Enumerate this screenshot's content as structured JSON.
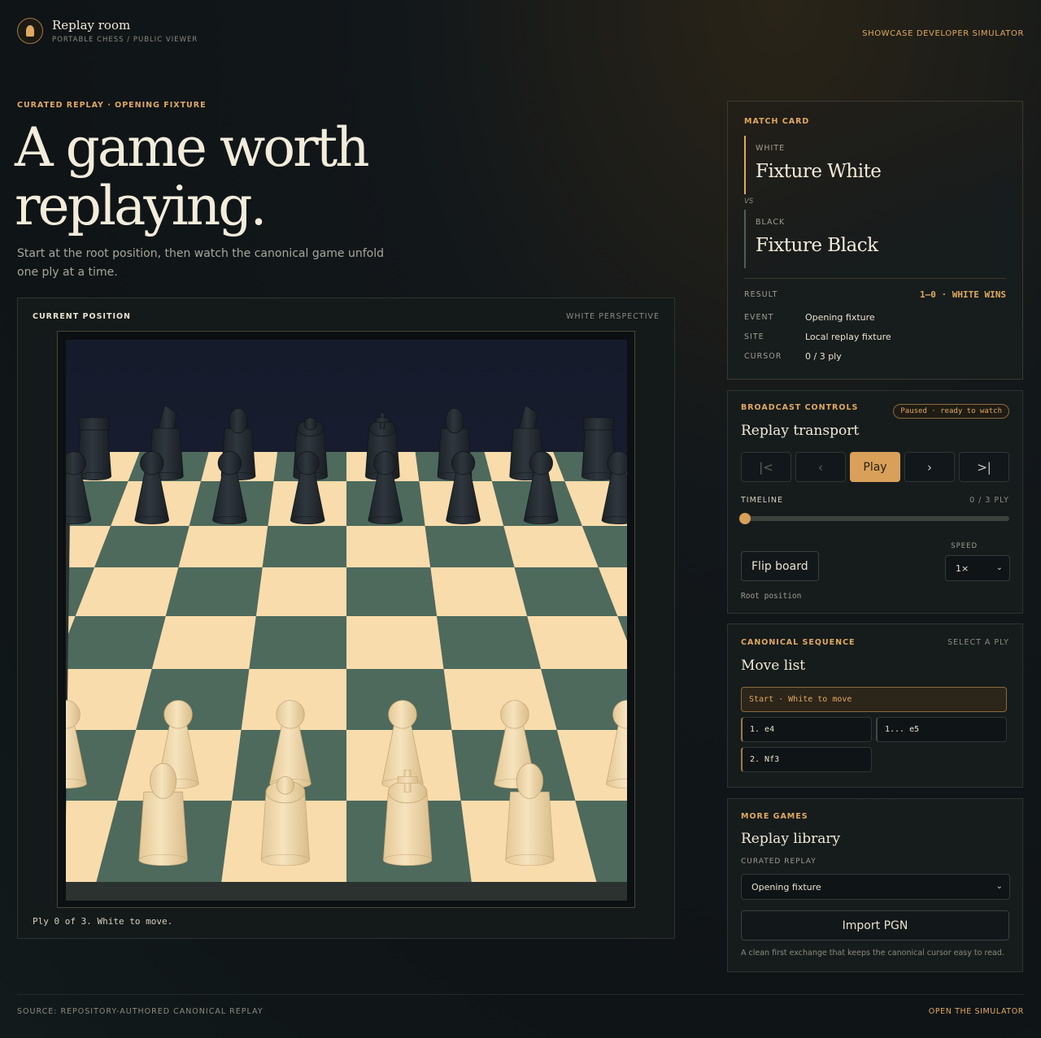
{
  "header": {
    "app_title": "Replay room",
    "app_subtitle": "PORTABLE CHESS / PUBLIC VIEWER",
    "logo_icon": "knight-icon",
    "dev_link": "SHOWCASE DEVELOPER SIMULATOR"
  },
  "hero": {
    "eyebrow": "CURATED REPLAY · OPENING FIXTURE",
    "title_line1": "A game worth",
    "title_line2": "replaying.",
    "subtitle": "Start at the root position, then watch the canonical game unfold one ply at a time."
  },
  "board": {
    "label": "CURRENT POSITION",
    "perspective": "WHITE PERSPECTIVE",
    "status": "Ply 0 of 3. White to move.",
    "colors": {
      "light_square": "#f9dcac",
      "dark_square": "#4d6a5d",
      "white_piece": "#f0d9ad",
      "black_piece": "#232a30"
    }
  },
  "match": {
    "eyebrow": "MATCH CARD",
    "white_label": "WHITE",
    "white_name": "Fixture White",
    "vs": "VS",
    "black_label": "BLACK",
    "black_name": "Fixture Black",
    "result_label": "RESULT",
    "result_value": "1–0 · WHITE WINS",
    "event_label": "EVENT",
    "event_value": "Opening fixture",
    "site_label": "SITE",
    "site_value": "Local replay fixture",
    "cursor_label": "CURSOR",
    "cursor_value": "0 / 3 ply"
  },
  "controls": {
    "eyebrow": "BROADCAST CONTROLS",
    "title": "Replay transport",
    "badge": "Paused · ready to watch",
    "first_label": "|<",
    "prev_label": "‹",
    "play_label": "Play",
    "next_label": "›",
    "last_label": ">|",
    "timeline_label": "TIMELINE",
    "timeline_value": "0 / 3 PLY",
    "timeline_progress": 0,
    "flip_label": "Flip board",
    "speed_label": "SPEED",
    "speed_value": "1×",
    "position_note": "Root position"
  },
  "moves": {
    "eyebrow": "CANONICAL SEQUENCE",
    "hint": "SELECT A PLY",
    "title": "Move list",
    "start": "Start · White to move",
    "items": [
      "1. e4",
      "1... e5",
      "2. Nf3"
    ]
  },
  "library": {
    "eyebrow": "MORE GAMES",
    "title": "Replay library",
    "select_label": "CURATED REPLAY",
    "select_value": "Opening fixture",
    "import_label": "Import PGN",
    "note": "A clean first exchange that keeps the canonical cursor easy to read."
  },
  "footer": {
    "source": "SOURCE: REPOSITORY-AUTHORED CANONICAL REPLAY",
    "link": "OPEN THE SIMULATOR"
  }
}
